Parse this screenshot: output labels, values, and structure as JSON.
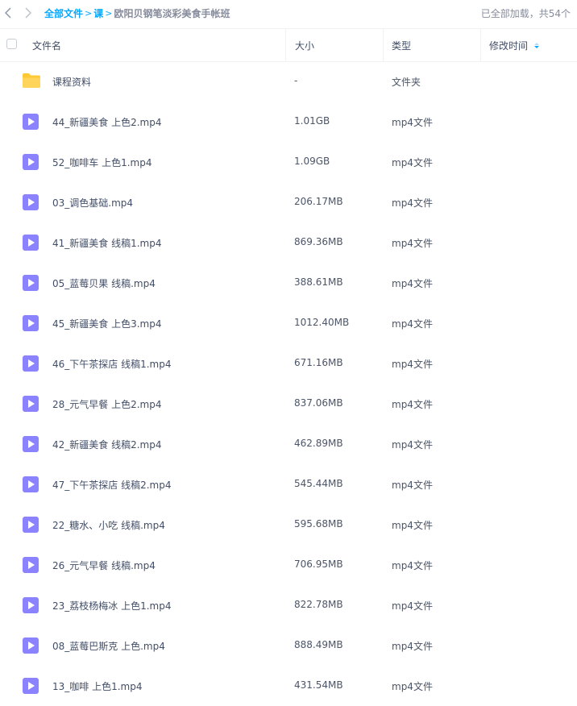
{
  "toolbar": {
    "back_icon": "chevron-left-icon",
    "forward_icon": "chevron-right-icon"
  },
  "breadcrumb": {
    "root": "全部文件",
    "separator": ">",
    "middle": "课",
    "current": "欧阳贝钢笔淡彩美食手帐班"
  },
  "status": {
    "loaded_text": "已全部加载，共54个"
  },
  "columns": {
    "name": "文件名",
    "size": "大小",
    "type": "类型",
    "modified": "修改时间"
  },
  "colors": {
    "accent": "#06a7ff",
    "video_icon": "#8b82ff",
    "folder_icon": "#ffc933"
  },
  "files": [
    {
      "name": "课程资料",
      "size": "-",
      "type": "文件夹",
      "icon": "folder-icon"
    },
    {
      "name": "44_新疆美食 上色2.mp4",
      "size": "1.01GB",
      "type": "mp4文件",
      "icon": "video-file-icon"
    },
    {
      "name": "52_咖啡车 上色1.mp4",
      "size": "1.09GB",
      "type": "mp4文件",
      "icon": "video-file-icon"
    },
    {
      "name": "03_调色基础.mp4",
      "size": "206.17MB",
      "type": "mp4文件",
      "icon": "video-file-icon"
    },
    {
      "name": "41_新疆美食 线稿1.mp4",
      "size": "869.36MB",
      "type": "mp4文件",
      "icon": "video-file-icon"
    },
    {
      "name": "05_蓝莓贝果 线稿.mp4",
      "size": "388.61MB",
      "type": "mp4文件",
      "icon": "video-file-icon"
    },
    {
      "name": "45_新疆美食 上色3.mp4",
      "size": "1012.40MB",
      "type": "mp4文件",
      "icon": "video-file-icon"
    },
    {
      "name": "46_下午茶探店 线稿1.mp4",
      "size": "671.16MB",
      "type": "mp4文件",
      "icon": "video-file-icon"
    },
    {
      "name": "28_元气早餐 上色2.mp4",
      "size": "837.06MB",
      "type": "mp4文件",
      "icon": "video-file-icon"
    },
    {
      "name": "42_新疆美食 线稿2.mp4",
      "size": "462.89MB",
      "type": "mp4文件",
      "icon": "video-file-icon"
    },
    {
      "name": "47_下午茶探店 线稿2.mp4",
      "size": "545.44MB",
      "type": "mp4文件",
      "icon": "video-file-icon"
    },
    {
      "name": "22_糖水、小吃 线稿.mp4",
      "size": "595.68MB",
      "type": "mp4文件",
      "icon": "video-file-icon"
    },
    {
      "name": "26_元气早餐 线稿.mp4",
      "size": "706.95MB",
      "type": "mp4文件",
      "icon": "video-file-icon"
    },
    {
      "name": "23_荔枝杨梅冰 上色1.mp4",
      "size": "822.78MB",
      "type": "mp4文件",
      "icon": "video-file-icon"
    },
    {
      "name": "08_蓝莓巴斯克 上色.mp4",
      "size": "888.49MB",
      "type": "mp4文件",
      "icon": "video-file-icon"
    },
    {
      "name": "13_咖啡 上色1.mp4",
      "size": "431.54MB",
      "type": "mp4文件",
      "icon": "video-file-icon"
    }
  ]
}
